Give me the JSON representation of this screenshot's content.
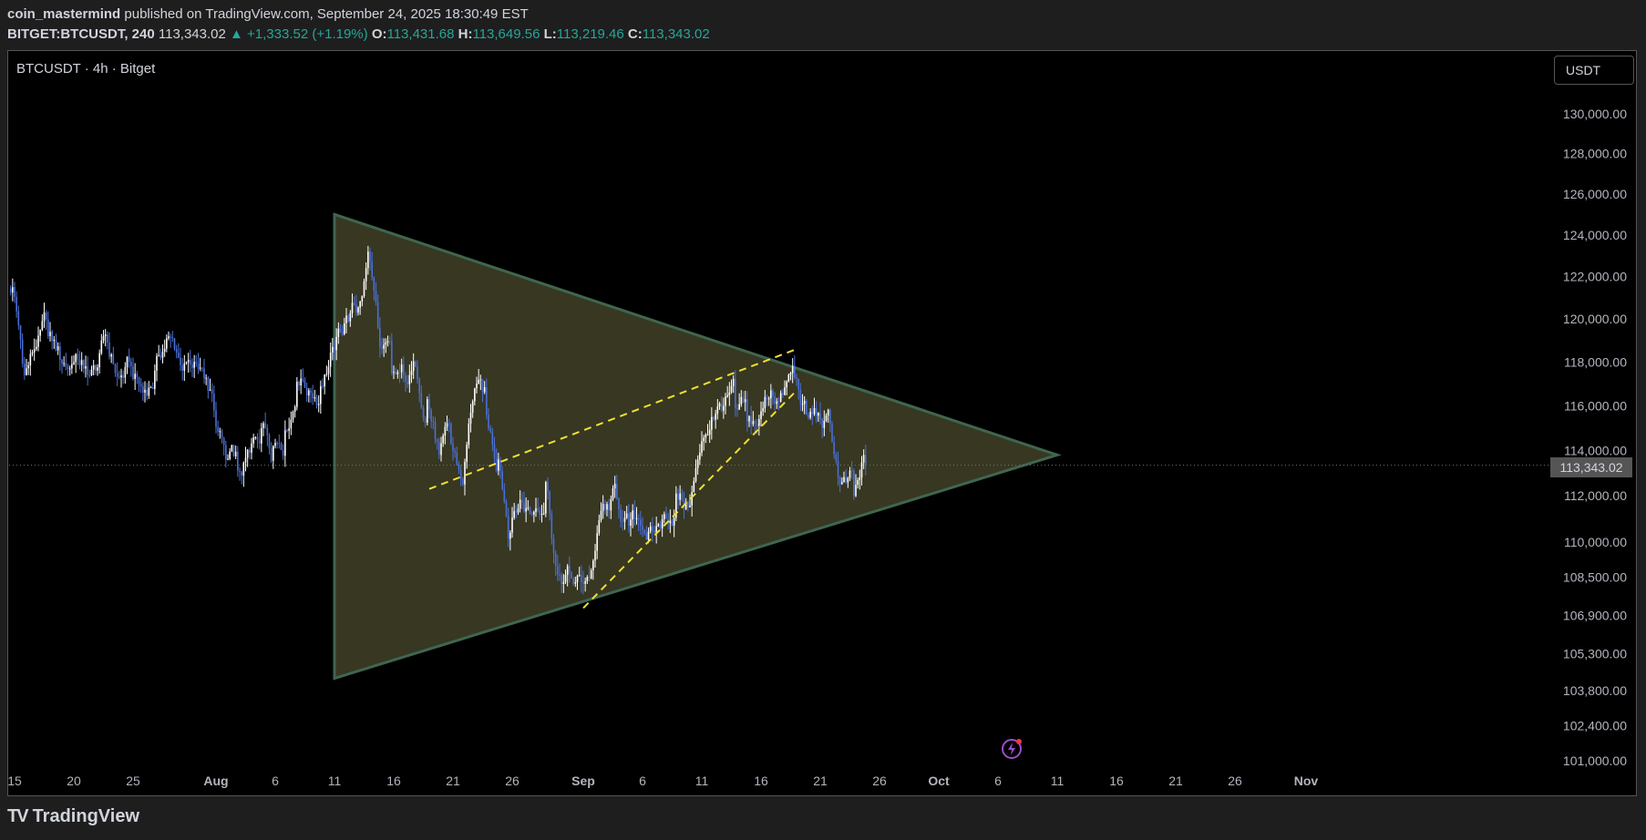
{
  "header": {
    "author": "coin_mastermind",
    "published": "published on TradingView.com, September 24, 2025 18:30:49 EST",
    "symbol_full": "BITGET:BTCUSDT, 240",
    "last": "113,343.02",
    "change": "▲ +1,333.52 (+1.19%)",
    "o_label": "O:",
    "o_value": "113,431.68",
    "h_label": "H:",
    "h_value": "113,649.56",
    "l_label": "L:",
    "l_value": "113,219.46",
    "c_label": "C:",
    "c_value": "113,343.02"
  },
  "pane": {
    "symbol_label": "BTCUSDT · 4h · Bitget",
    "unit_button": "USDT",
    "current_price_tag": "113,343.02"
  },
  "footer": {
    "brand": "TradingView",
    "logo": "TV"
  },
  "colors": {
    "background": "#000000",
    "up": "#ffffff",
    "down": "#4a6fd6",
    "triangle_fill": "#3a3a24",
    "triangle_stroke": "#3f6650",
    "dashed": "#f0e130",
    "accent": "#26a69a"
  },
  "chart_data": {
    "type": "candlestick",
    "y_ticks": [
      "130,000.00",
      "128,000.00",
      "126,000.00",
      "124,000.00",
      "122,000.00",
      "120,000.00",
      "118,000.00",
      "116,000.00",
      "114,000.00",
      "112,000.00",
      "110,000.00",
      "108,500.00",
      "106,900.00",
      "105,300.00",
      "103,800.00",
      "102,400.00",
      "101,000.00"
    ],
    "y_tick_values": [
      130000,
      128000,
      126000,
      124000,
      122000,
      120000,
      118000,
      116000,
      114000,
      112000,
      110000,
      108500,
      106900,
      105300,
      103800,
      102400,
      101000
    ],
    "y_scale": "log",
    "x_ticks": [
      "15",
      "20",
      "25",
      "Aug",
      "6",
      "11",
      "16",
      "21",
      "26",
      "Sep",
      "6",
      "11",
      "16",
      "21",
      "26",
      "Oct",
      "6",
      "11",
      "16",
      "21",
      "26",
      "Nov"
    ],
    "x_tick_dates": [
      "2025-07-15",
      "2025-07-20",
      "2025-07-25",
      "2025-08-01",
      "2025-08-06",
      "2025-08-11",
      "2025-08-16",
      "2025-08-21",
      "2025-08-26",
      "2025-09-01",
      "2025-09-06",
      "2025-09-11",
      "2025-09-16",
      "2025-09-21",
      "2025-09-26",
      "2025-10-01",
      "2025-10-06",
      "2025-10-11",
      "2025-10-16",
      "2025-10-21",
      "2025-10-26",
      "2025-11-01"
    ],
    "last_price": 113343.02,
    "series_close": [
      [
        "2025-07-14",
        121500
      ],
      [
        "2025-07-15",
        117400
      ],
      [
        "2025-07-16",
        118700
      ],
      [
        "2025-07-17",
        119200
      ],
      [
        "2025-07-18",
        118100
      ],
      [
        "2025-07-19",
        117900
      ],
      [
        "2025-07-20",
        117700
      ],
      [
        "2025-07-21",
        117600
      ],
      [
        "2025-07-22",
        118900
      ],
      [
        "2025-07-23",
        117300
      ],
      [
        "2025-07-24",
        117800
      ],
      [
        "2025-07-25",
        116600
      ],
      [
        "2025-07-26",
        117600
      ],
      [
        "2025-07-27",
        119100
      ],
      [
        "2025-07-28",
        118200
      ],
      [
        "2025-07-29",
        117900
      ],
      [
        "2025-07-30",
        117700
      ],
      [
        "2025-07-31",
        115800
      ],
      [
        "2025-08-01",
        113600
      ],
      [
        "2025-08-02",
        113100
      ],
      [
        "2025-08-03",
        113900
      ],
      [
        "2025-08-04",
        115000
      ],
      [
        "2025-08-05",
        114200
      ],
      [
        "2025-08-06",
        114900
      ],
      [
        "2025-08-07",
        117100
      ],
      [
        "2025-08-08",
        116700
      ],
      [
        "2025-08-09",
        116900
      ],
      [
        "2025-08-10",
        118700
      ],
      [
        "2025-08-11",
        119800
      ],
      [
        "2025-08-12",
        120300
      ],
      [
        "2025-08-13",
        123200
      ],
      [
        "2025-08-14",
        118700
      ],
      [
        "2025-08-15",
        117500
      ],
      [
        "2025-08-16",
        117400
      ],
      [
        "2025-08-17",
        117800
      ],
      [
        "2025-08-18",
        116300
      ],
      [
        "2025-08-19",
        113800
      ],
      [
        "2025-08-20",
        114300
      ],
      [
        "2025-08-21",
        112500
      ],
      [
        "2025-08-22",
        116800
      ],
      [
        "2025-08-23",
        115600
      ],
      [
        "2025-08-24",
        113600
      ],
      [
        "2025-08-25",
        110400
      ],
      [
        "2025-08-26",
        111700
      ],
      [
        "2025-08-27",
        111300
      ],
      [
        "2025-08-28",
        112600
      ],
      [
        "2025-08-29",
        108600
      ],
      [
        "2025-08-30",
        108700
      ],
      [
        "2025-08-31",
        108300
      ],
      [
        "2025-09-01",
        109200
      ],
      [
        "2025-09-02",
        111400
      ],
      [
        "2025-09-03",
        111900
      ],
      [
        "2025-09-04",
        110700
      ],
      [
        "2025-09-05",
        110700
      ],
      [
        "2025-09-06",
        110500
      ],
      [
        "2025-09-07",
        111200
      ],
      [
        "2025-09-08",
        112100
      ],
      [
        "2025-09-09",
        111500
      ],
      [
        "2025-09-10",
        113900
      ],
      [
        "2025-09-11",
        115500
      ],
      [
        "2025-09-12",
        116000
      ],
      [
        "2025-09-13",
        115900
      ],
      [
        "2025-09-14",
        115300
      ],
      [
        "2025-09-15",
        115400
      ],
      [
        "2025-09-16",
        116700
      ],
      [
        "2025-09-17",
        116500
      ],
      [
        "2025-09-18",
        117300
      ],
      [
        "2025-09-19",
        115600
      ],
      [
        "2025-09-20",
        115700
      ],
      [
        "2025-09-21",
        115200
      ],
      [
        "2025-09-22",
        112600
      ],
      [
        "2025-09-23",
        112000
      ],
      [
        "2025-09-24",
        113343
      ]
    ],
    "trendlines": {
      "triangle_top": [
        [
          "2025-08-11",
          125000
        ],
        [
          "2025-10-11",
          113800
        ]
      ],
      "triangle_bottom": [
        [
          "2025-08-11",
          104300
        ],
        [
          "2025-10-11",
          113800
        ]
      ],
      "dashed_upper": [
        [
          "2025-08-19",
          112300
        ],
        [
          "2025-09-19",
          118600
        ]
      ],
      "dashed_lower": [
        [
          "2025-09-01",
          107200
        ],
        [
          "2025-09-19",
          116700
        ]
      ]
    }
  }
}
